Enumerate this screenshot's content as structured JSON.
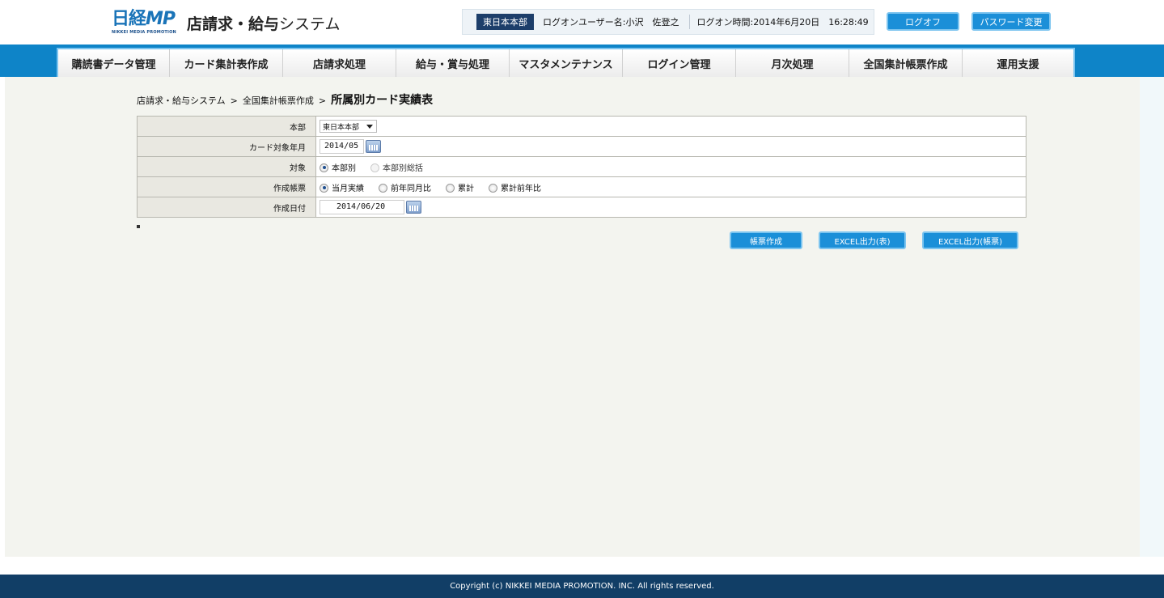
{
  "header": {
    "logo_text": "日経",
    "logo_mp": "MP",
    "logo_sub": "NIKKEI MEDIA PROMOTION",
    "app_title_bold": "店請求・給与",
    "app_title_rest": "システム",
    "hq": "東日本本部",
    "user": "ログオンユーザー名:小沢　佐登之",
    "login_time": "ログオン時間:2014年6月20日　16:28:49",
    "logoff": "ログオフ",
    "change_password": "パスワード変更"
  },
  "nav": [
    "購読書データ管理",
    "カード集計表作成",
    "店請求処理",
    "給与・賞与処理",
    "マスタメンテナンス",
    "ログイン管理",
    "月次処理",
    "全国集計帳票作成",
    "運用支援"
  ],
  "breadcrumb": {
    "item1": "店請求・給与システム",
    "item2": "全国集計帳票作成",
    "current": "所属別カード実績表",
    "arrow": ">"
  },
  "form": {
    "hq_label": "本部",
    "hq_value": "東日本本部",
    "card_month_label": "カード対象年月",
    "card_month_value": "2014/05",
    "target_label": "対象",
    "target_opt1": "本部別",
    "target_opt2": "本部別総括",
    "report_label": "作成帳票",
    "report_opt1": "当月実績",
    "report_opt2": "前年同月比",
    "report_opt3": "累計",
    "report_opt4": "累計前年比",
    "date_label": "作成日付",
    "date_value": "2014/06/20"
  },
  "actions": {
    "make": "帳票作成",
    "excel_table": "EXCEL出力(表)",
    "excel_report": "EXCEL出力(帳票)"
  },
  "footer": {
    "copyright": "Copyright (c) NIKKEI MEDIA PROMOTION. INC. All rights reserved."
  }
}
